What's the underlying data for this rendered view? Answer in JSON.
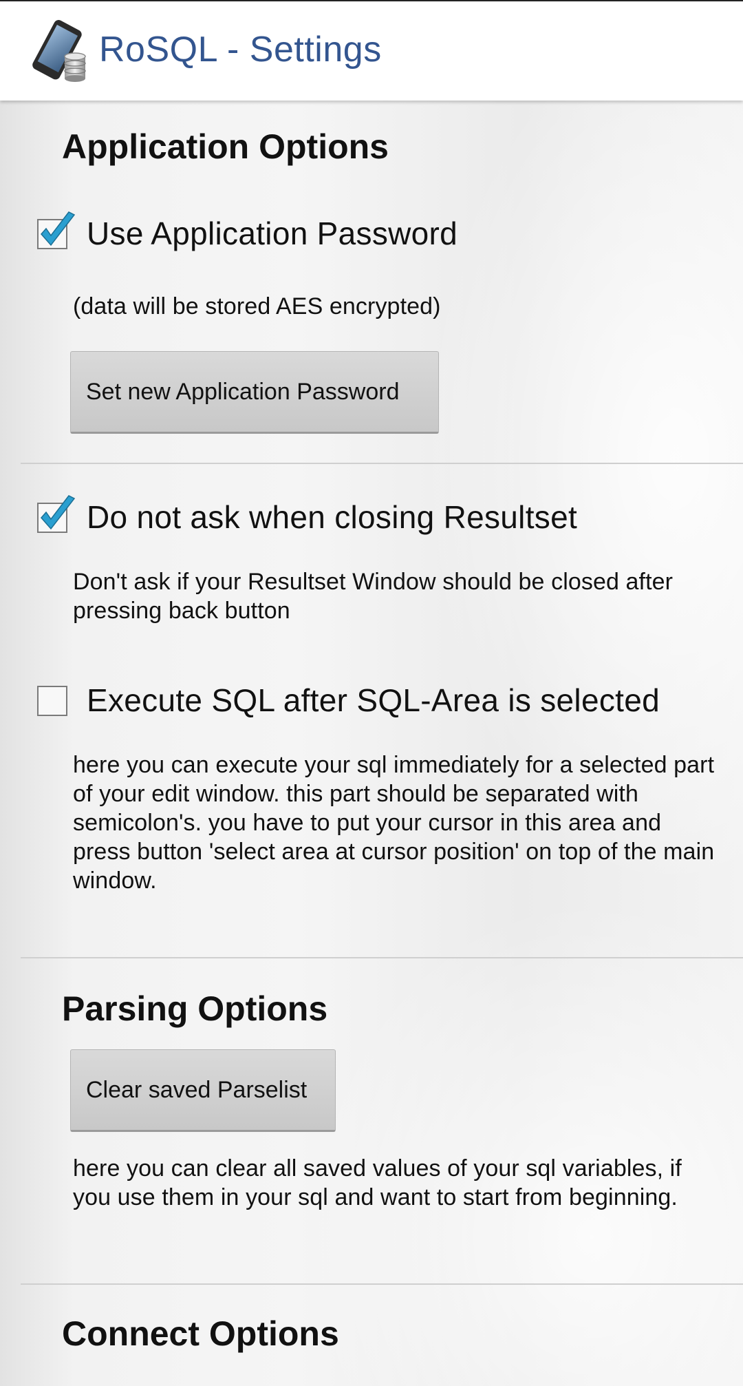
{
  "app": {
    "title": "RoSQL - Settings"
  },
  "sections": {
    "application_options": {
      "title": "Application Options",
      "use_password": {
        "label": "Use Application Password",
        "checked": true,
        "description": "(data will be stored AES encrypted)",
        "button_label": "Set new Application Password"
      },
      "no_ask_closing": {
        "label": "Do not ask when closing Resultset",
        "checked": true,
        "description": "Don't ask if your Resultset Window should be closed after pressing back button"
      },
      "execute_sql_area": {
        "label": "Execute SQL after SQL-Area is selected",
        "checked": false,
        "description": "here you can execute your sql immediately for a selected part of your edit window. this part should be separated with semicolon's. you have to put your cursor in this area and press button 'select area at cursor position' on top of the main window."
      }
    },
    "parsing_options": {
      "title": "Parsing Options",
      "button_label": "Clear saved Parselist",
      "description": "here you can clear all saved values of your sql variables, if you use them in your sql and want to start from beginning."
    },
    "connect_options": {
      "title": "Connect Options"
    }
  },
  "colors": {
    "title_blue": "#33558f",
    "check_blue": "#2a9fd0",
    "button_gray": "#d0d0d0"
  }
}
